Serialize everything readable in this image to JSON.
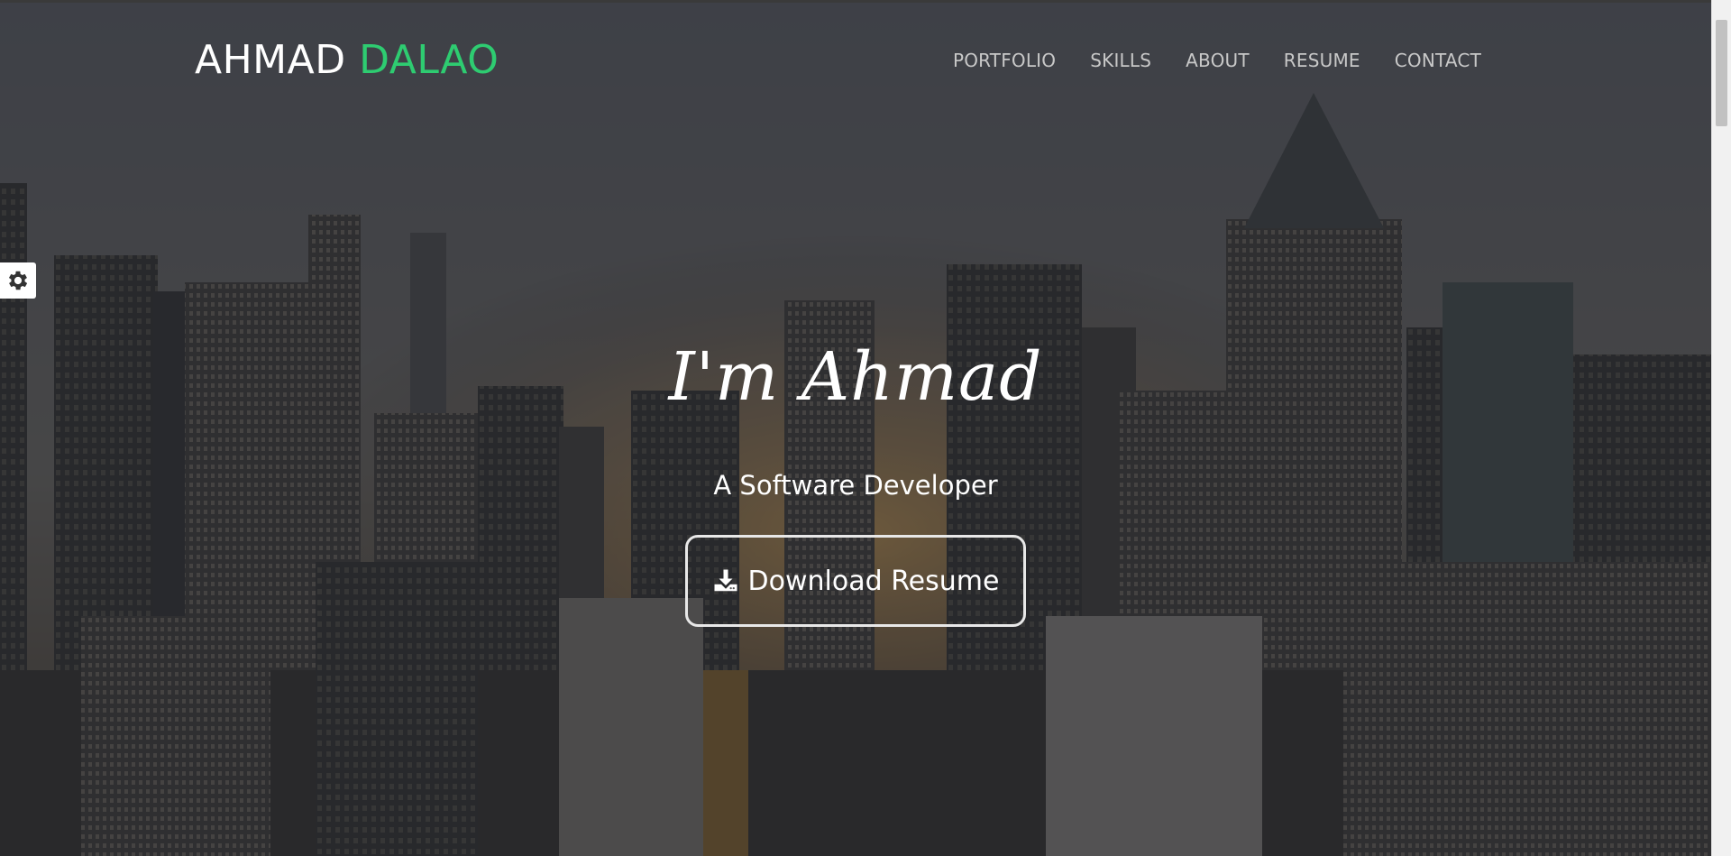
{
  "header": {
    "brand_first": "AHMAD",
    "brand_last": "DALAO",
    "nav": [
      "PORTFOLIO",
      "SKILLS",
      "ABOUT",
      "RESUME",
      "CONTACT"
    ]
  },
  "hero": {
    "heading": "I'm Ahmad",
    "subtitle": "A Software Developer",
    "download_label": "Download Resume"
  },
  "icons": {
    "settings": "gear-icon",
    "download": "download-icon"
  },
  "colors": {
    "accent": "#2ecc71",
    "text": "#ffffff",
    "nav_text": "#c8c8c8"
  }
}
